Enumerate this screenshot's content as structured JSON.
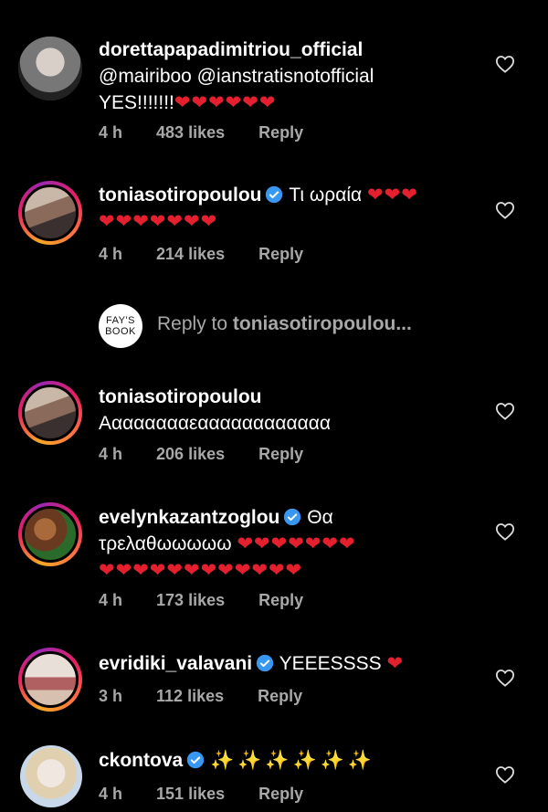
{
  "comments": [
    {
      "username": "dorettapapadimitriou_official",
      "verified": false,
      "line1": "@mairiboo @ianstratisnotofficial",
      "line2_text": "YES!!!!!!!",
      "line2_hearts": "❤❤❤❤❤❤",
      "time": "4 h",
      "likes": "483 likes",
      "reply": "Reply"
    },
    {
      "username": "toniasotiropoulou",
      "verified": true,
      "inline_text": "Τι ωραία",
      "inline_hearts": "❤❤❤",
      "line2_hearts": "❤❤❤❤❤❤❤",
      "time": "4 h",
      "likes": "214 likes",
      "reply": "Reply"
    },
    {
      "username": "toniasotiropoulou",
      "verified": false,
      "line1": "Ααααααααεαααααααααααα",
      "time": "4 h",
      "likes": "206 likes",
      "reply": "Reply"
    },
    {
      "username": "evelynkazantzoglou",
      "verified": true,
      "inline_text": "Θα",
      "line1": "τρελαθωωωωω",
      "line1_hearts": "❤❤❤❤❤❤❤",
      "line2_hearts": "❤❤❤❤❤❤❤❤❤❤❤❤",
      "time": "4 h",
      "likes": "173 likes",
      "reply": "Reply"
    },
    {
      "username": "evridiki_valavani",
      "verified": true,
      "inline_text": "YEEESSSS",
      "inline_hearts": "❤",
      "time": "3 h",
      "likes": "112 likes",
      "reply": "Reply"
    },
    {
      "username": "ckontova",
      "verified": true,
      "inline_sparkles": "✨✨✨✨✨✨",
      "time": "4 h",
      "likes": "151 likes",
      "reply": "Reply"
    }
  ],
  "reply_box": {
    "avatar_text": "FAY'S BOOK",
    "prefix": "Reply to ",
    "target": "toniasotiropoulou..."
  },
  "colors": {
    "background": "#000000",
    "heart": "#e5202e",
    "meta": "#a8a8a8",
    "verified": "#3897f0"
  }
}
